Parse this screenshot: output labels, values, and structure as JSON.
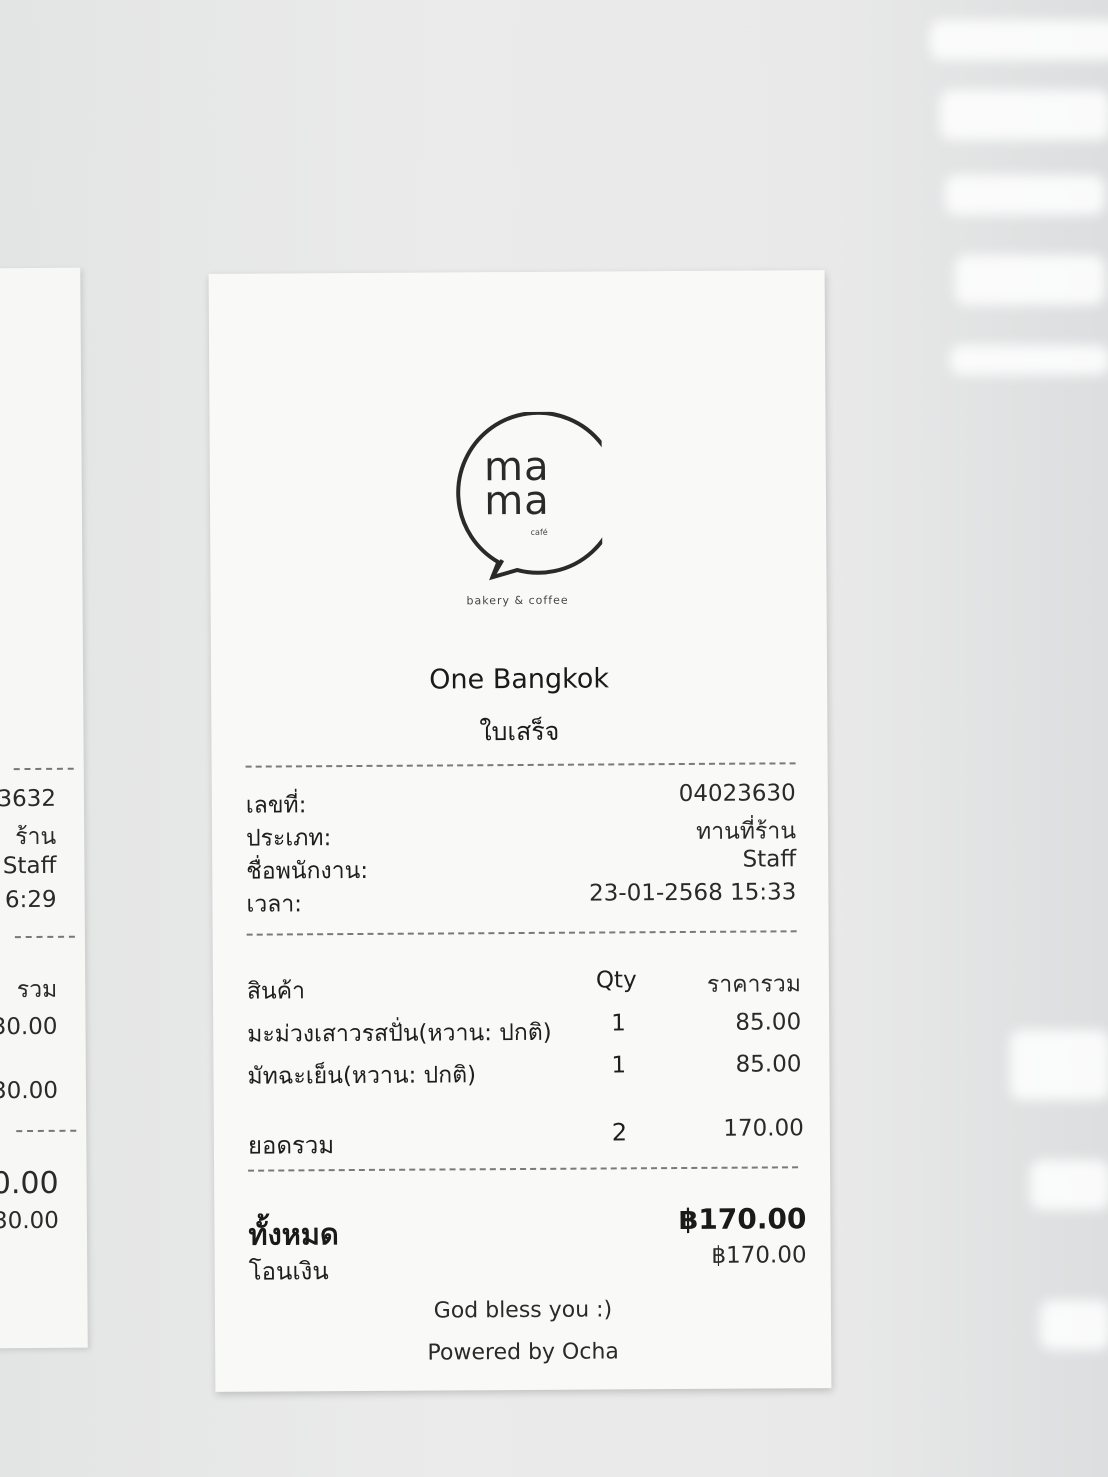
{
  "left_receipt": {
    "fragments": [
      "3632",
      "ร้าน",
      "Staff",
      "6:29",
      "รวม",
      "30.00",
      "30.00",
      "0.00",
      "30.00"
    ]
  },
  "receipt": {
    "logo": {
      "line1": "ma",
      "line2": "ma",
      "sub": "café",
      "tagline": "bakery & coffee"
    },
    "branch": "One Bangkok",
    "doc_type": "ใบเสร็จ",
    "info": [
      {
        "label": "เลขที่:",
        "value": "04023630"
      },
      {
        "label": "ประเภท:",
        "value": "ทานที่ร้าน"
      },
      {
        "label": "ชื่อพนักงาน:",
        "value": "Staff"
      },
      {
        "label": "เวลา:",
        "value": "23-01-2568 15:33"
      }
    ],
    "columns": {
      "item": "สินค้า",
      "qty": "Qty",
      "total": "ราคารวม"
    },
    "items": [
      {
        "name": "มะม่วงเสาวรสปั่น(หวาน: ปกติ)",
        "qty": "1",
        "total": "85.00"
      },
      {
        "name": "มัทฉะเย็น(หวาน: ปกติ)",
        "qty": "1",
        "total": "85.00"
      }
    ],
    "subtotal": {
      "label": "ยอดรวม",
      "qty": "2",
      "total": "170.00"
    },
    "grand_total": {
      "label": "ทั้งหมด",
      "value": "฿170.00"
    },
    "payment": {
      "label": "โอนเงิน",
      "value": "฿170.00"
    },
    "footer": {
      "line1": "God bless you :)",
      "line2": "Powered by Ocha"
    }
  }
}
